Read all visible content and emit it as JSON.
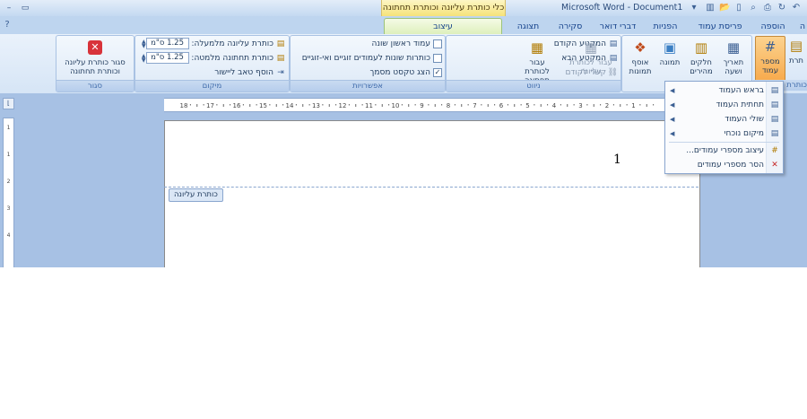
{
  "titlebar": {
    "app_title": "Microsoft Word - Document1",
    "context_title": "כלי כותרת עליונה וכותרת תחתונה"
  },
  "qat": {
    "icons": [
      "undo-icon",
      "redo-icon",
      "print-preview-icon",
      "spelling-icon",
      "new-icon",
      "open-icon",
      "save-icon",
      "chart-icon"
    ]
  },
  "tabs": {
    "home": "הוספה",
    "insert": "פריסת עמוד",
    "references": "הפניות",
    "mailings": "דברי דואר",
    "review": "סקירה",
    "view": "תצוגה",
    "design": "עיצוב",
    "partial_left": "ה",
    "partial_right": "וספה"
  },
  "ribbon": {
    "headerfooter_group": {
      "label": "כותרת",
      "header_partial": "תרת",
      "header_partial2": "תונה"
    },
    "insert_group": {
      "label": "הוספה",
      "page_number": "מספר עמוד",
      "date_time": "תאריך ושעה",
      "quick_parts": "חלקים מהירים",
      "picture": "תמונה",
      "clipart": "אוסף תמונות"
    },
    "navigation_group": {
      "label": "ניווט",
      "goto_header": "עבור לכותרת עליונה",
      "goto_footer": "עבור לכותרת תחתונה",
      "previous_section": "המקטע הקודם",
      "next_section": "המקטע הבא",
      "link_to_previous": "קשר לקודם"
    },
    "options_group": {
      "label": "אפשרויות",
      "different_first_page": "עמוד ראשון שונה",
      "different_odd_even": "כותרות שונות לעמודים זוגיים ואי-זוגיים",
      "show_document_text": "הצג טקסט מסמך",
      "show_document_text_checked": "✓"
    },
    "position_group": {
      "label": "מיקום",
      "header_from_top": "כותרת עליונה מלמעלה:",
      "footer_from_bottom": "כותרת תחתונה מלמטה:",
      "insert_alignment_tab": "הוסף טאב ליישור",
      "header_value": "1.25 ס\"מ",
      "footer_value": "1.25 ס\"מ"
    },
    "close_group": {
      "label": "סגור",
      "close_button": "סגור כותרת עליונה וכותרת תחתונה"
    }
  },
  "menu": {
    "items": [
      {
        "label": "בראש העמוד",
        "icon": "page-top-icon",
        "submenu": true
      },
      {
        "label": "תחתית העמוד",
        "icon": "page-bottom-icon",
        "submenu": true
      },
      {
        "label": "שולי העמוד",
        "icon": "page-margins-icon",
        "submenu": true
      },
      {
        "label": "מיקום נוכחי",
        "icon": "current-position-icon",
        "submenu": true
      },
      {
        "label": "עיצוב מספרי עמודים...",
        "icon": "format-page-numbers-icon",
        "submenu": false
      },
      {
        "label": "הסר מספרי עמודים",
        "icon": "remove-page-numbers-icon",
        "submenu": false
      }
    ]
  },
  "document": {
    "header_tag": "כותרת עליונה",
    "page_number": "1"
  },
  "ruler": {
    "ticks": [
      "18",
      "17",
      "16",
      "15",
      "14",
      "13",
      "12",
      "11",
      "10",
      "9",
      "8",
      "7",
      "6",
      "5",
      "4",
      "3",
      "2",
      "1"
    ],
    "vticks": [
      "1",
      "1",
      "2",
      "3",
      "4"
    ]
  },
  "colors": {
    "accent": "#15428b",
    "ribbon_bg": "#d6e5f6",
    "active_tab": "#dcefb9",
    "workspace": "#a7c1e4"
  }
}
